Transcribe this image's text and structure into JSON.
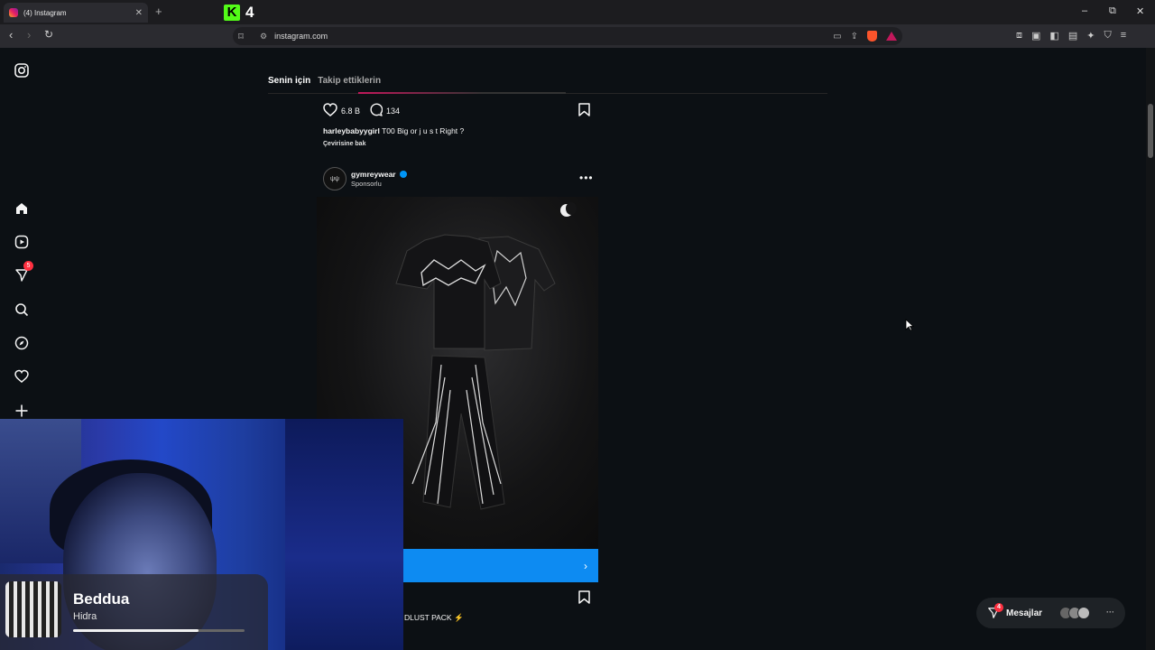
{
  "browser": {
    "tab_title": "(4) Instagram",
    "tab_close": "✕",
    "new_tab": "+",
    "kick_count": "4",
    "url": "instagram.com",
    "win_min": "–",
    "win_max": "⧉",
    "win_close": "✕"
  },
  "feed": {
    "tab_for_you": "Senin için",
    "tab_following": "Takip ettiklerin"
  },
  "post1": {
    "likes": "6.8 B",
    "comments": "134",
    "username": "harleybabyygirl",
    "caption": "T00 Big or j u s t Right ?",
    "see_translation": "Çevirisine bak"
  },
  "post2": {
    "avatar_text": "ψψ",
    "username": "gymreywear",
    "sponsored": "Sponsorlu",
    "more": "•••",
    "cta_chevron": "›",
    "caption": "DLUST PACK ⚡"
  },
  "sidebar": {
    "notifications_badge": "5"
  },
  "music": {
    "song": "Beddua",
    "artist": "Hidra",
    "progress": 0.73
  },
  "messages": {
    "label": "Mesajlar",
    "badge": "4",
    "more": "···"
  }
}
